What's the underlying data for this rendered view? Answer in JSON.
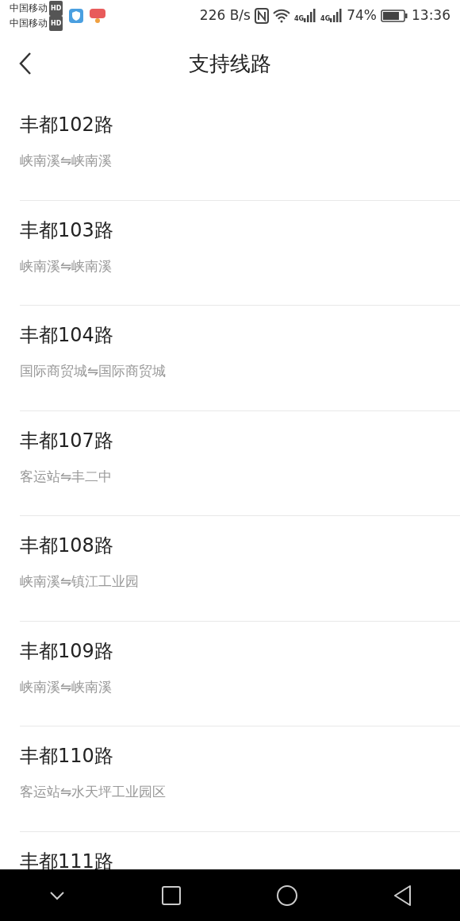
{
  "status_bar": {
    "carriers": [
      {
        "name": "中国移动",
        "badge": "HD"
      },
      {
        "name": "中国移动",
        "badge": "HD"
      }
    ],
    "speed": "226 B/s",
    "networks": [
      "4G",
      "4G"
    ],
    "battery": "74%",
    "time": "13:36"
  },
  "header": {
    "title": "支持线路"
  },
  "routes": [
    {
      "name": "丰都102路",
      "stops": "峡南溪⇋峡南溪"
    },
    {
      "name": "丰都103路",
      "stops": "峡南溪⇋峡南溪"
    },
    {
      "name": "丰都104路",
      "stops": "国际商贸城⇋国际商贸城"
    },
    {
      "name": "丰都107路",
      "stops": "客运站⇋丰二中"
    },
    {
      "name": "丰都108路",
      "stops": "峡南溪⇋镇江工业园"
    },
    {
      "name": "丰都109路",
      "stops": "峡南溪⇋峡南溪"
    },
    {
      "name": "丰都110路",
      "stops": "客运站⇋水天坪工业园区"
    },
    {
      "name": "丰都111路"
    }
  ]
}
